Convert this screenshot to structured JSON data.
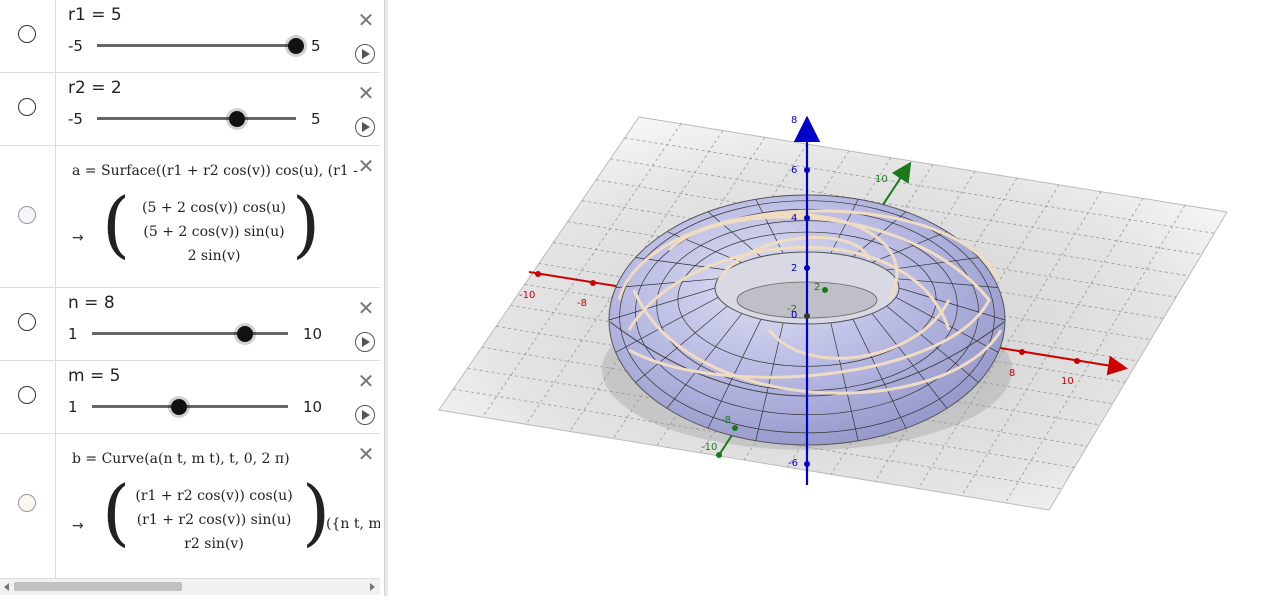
{
  "algebra": {
    "sliders": [
      {
        "id": "r1",
        "label": "r1 = 5",
        "min": "-5",
        "max": "5",
        "value": 5,
        "range": [
          -5,
          5
        ]
      },
      {
        "id": "r2",
        "label": "r2 = 2",
        "min": "-5",
        "max": "5",
        "value": 2,
        "range": [
          -5,
          5
        ]
      },
      {
        "id": "n",
        "label": "n = 8",
        "min": "1",
        "max": "10",
        "value": 8,
        "range": [
          1,
          10
        ]
      },
      {
        "id": "m",
        "label": "m = 5",
        "min": "1",
        "max": "10",
        "value": 5,
        "range": [
          1,
          10
        ]
      }
    ],
    "surface": {
      "definition": "a = Surface((r1 + r2  cos(v))  cos(u), (r1 -",
      "arrow": "→",
      "rows": [
        "(5 + 2  cos(v))  cos(u)",
        "(5 + 2  cos(v))  sin(u)",
        "2  sin(v)"
      ]
    },
    "curve": {
      "definition": "b = Curve(a(n t, m t), t, 0, 2 π)",
      "arrow": "→",
      "rows": [
        "(r1 + r2  cos(v))  cos(u)",
        "(r1 + r2  cos(v))  sin(u)",
        "r2  sin(v)"
      ],
      "tail": "({n t, m"
    }
  },
  "view3d": {
    "colors": {
      "x_axis": "#cc0000",
      "y_axis": "#1a7a1a",
      "z_axis": "#0000cc",
      "surface": "#a9acd8",
      "curve": "#f0dcc0",
      "plane": "#d8d8d8"
    },
    "x_ticks": [
      "-10",
      "-8",
      "8",
      "10"
    ],
    "y_ticks": [
      "-10",
      "-8",
      "-2",
      "2",
      "10"
    ],
    "z_ticks": [
      "8",
      "6",
      "4",
      "2",
      "0",
      "-6"
    ]
  }
}
